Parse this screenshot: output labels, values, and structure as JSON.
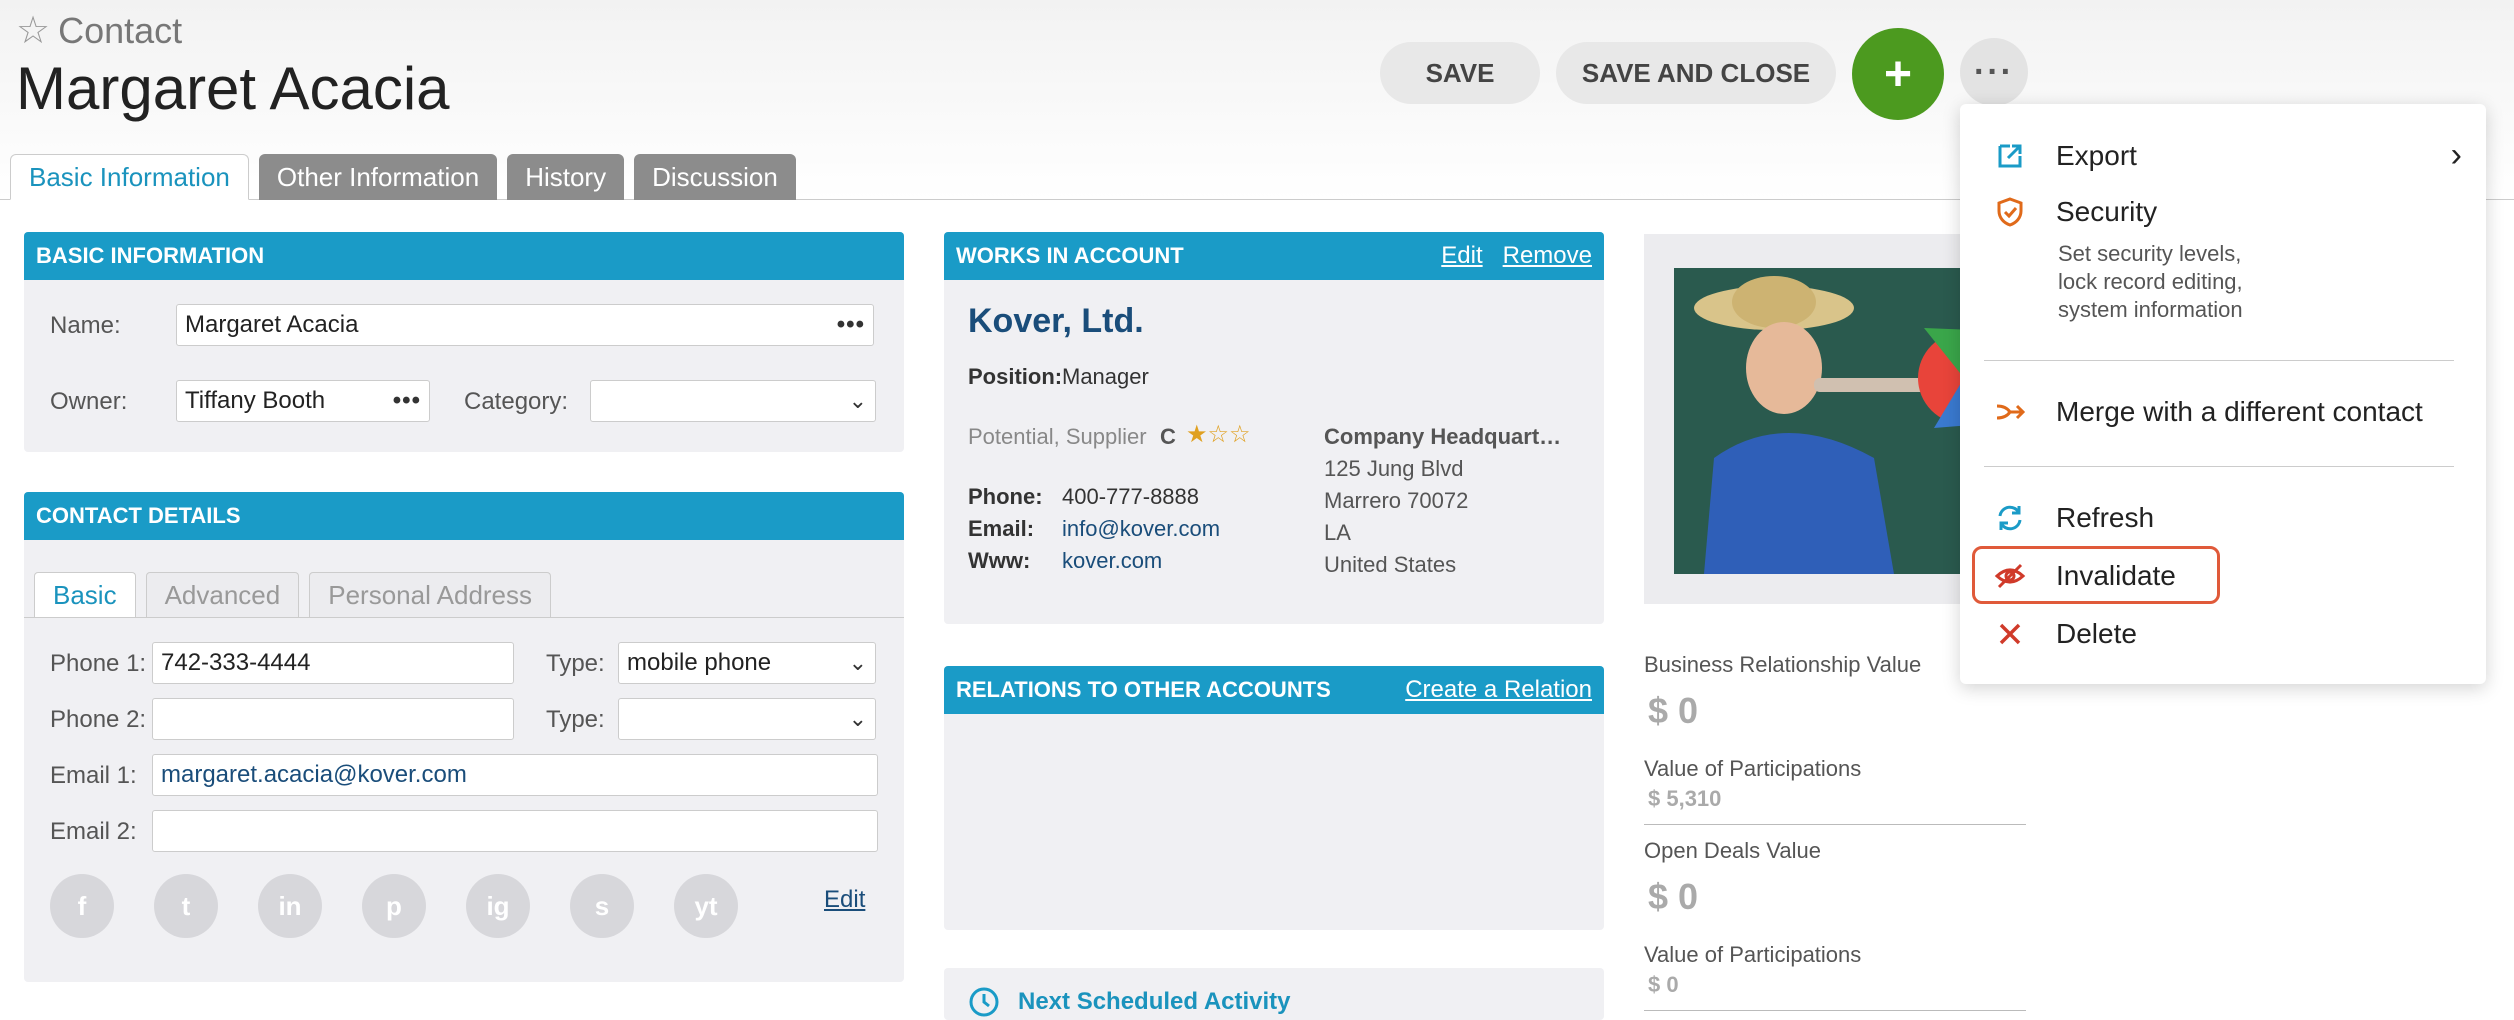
{
  "header": {
    "kind": "Contact",
    "title": "Margaret Acacia",
    "save_label": "SAVE",
    "save_close_label": "SAVE AND CLOSE",
    "add_label": "+",
    "more_label": "···"
  },
  "tabs": [
    {
      "label": "Basic Information"
    },
    {
      "label": "Other Information"
    },
    {
      "label": "History"
    },
    {
      "label": "Discussion"
    }
  ],
  "basic_info": {
    "heading": "BASIC INFORMATION",
    "name_label": "Name:",
    "name_value": "Margaret Acacia",
    "owner_label": "Owner:",
    "owner_value": "Tiffany Booth",
    "category_label": "Category:",
    "category_value": ""
  },
  "contact_details": {
    "heading": "CONTACT DETAILS",
    "subtabs": [
      "Basic",
      "Advanced",
      "Personal Address"
    ],
    "phone1_label": "Phone 1:",
    "phone1_value": "742-333-4444",
    "type1_label": "Type:",
    "type1_value": "mobile phone",
    "phone2_label": "Phone 2:",
    "phone2_value": "",
    "type2_label": "Type:",
    "type2_value": "",
    "email1_label": "Email 1:",
    "email1_value": "margaret.acacia@kover.com",
    "email2_label": "Email 2:",
    "email2_value": "",
    "edit_label": "Edit",
    "social": [
      "f",
      "t",
      "in",
      "p",
      "ig",
      "s",
      "yt"
    ]
  },
  "works_in_account": {
    "heading": "WORKS IN ACCOUNT",
    "edit_label": "Edit",
    "remove_label": "Remove",
    "account_name": "Kover, Ltd.",
    "position_label": "Position:",
    "position_value": "Manager",
    "relation": "Potential, Supplier",
    "grade": "C",
    "stars": "★☆☆",
    "rating": 1,
    "rating_max": 3,
    "phone_label": "Phone:",
    "phone_value": "400-777-8888",
    "email_label": "Email:",
    "email_value": "info@kover.com",
    "www_label": "Www:",
    "www_value": "kover.com",
    "hq_label": "Company Headquart…",
    "hq_line1": "125 Jung Blvd",
    "hq_line2": "Marrero 70072",
    "hq_line3": "LA",
    "hq_line4": "United States"
  },
  "relations": {
    "heading": "RELATIONS TO OTHER ACCOUNTS",
    "create_label": "Create a Relation"
  },
  "next_activity": {
    "label": "Next Scheduled Activity"
  },
  "values": {
    "brv_label": "Business Relationship Value",
    "brv_value": "$ 0",
    "vop1_label": "Value of Participations",
    "vop1_value": "$ 5,310",
    "odv_label": "Open Deals Value",
    "odv_value": "$ 0",
    "vop2_label": "Value of Participations",
    "vop2_value": "$ 0"
  },
  "menu": {
    "items": [
      {
        "label": "Export",
        "icon": "export-icon"
      },
      {
        "label": "Security",
        "icon": "shield-icon"
      },
      {
        "label": "Merge with a different contact",
        "icon": "merge-icon"
      },
      {
        "label": "Refresh",
        "icon": "refresh-icon"
      },
      {
        "label": "Invalidate",
        "icon": "eye-off-icon"
      },
      {
        "label": "Delete",
        "icon": "close-icon"
      }
    ],
    "security_desc_1": "Set security levels,",
    "security_desc_2": "lock record editing,",
    "security_desc_3": "system information",
    "submenu_arrow": "›"
  },
  "colors": {
    "accent": "#1a9bc7",
    "add_button": "#4c9a1f",
    "highlight": "#e05a3a"
  }
}
